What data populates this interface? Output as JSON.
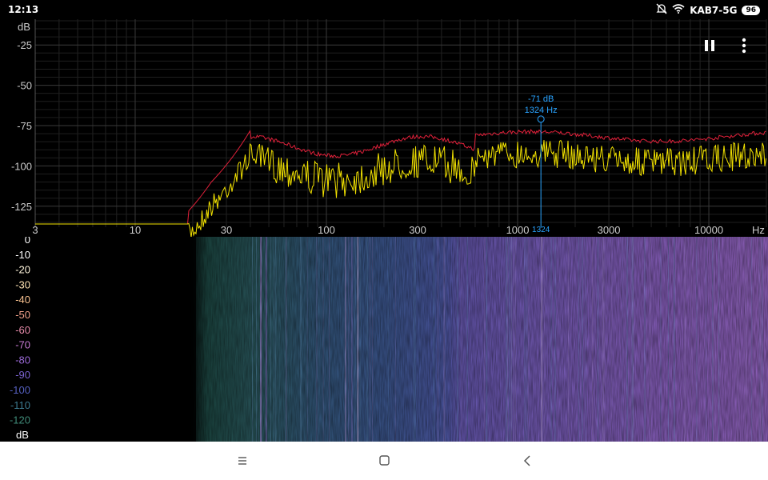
{
  "status_bar": {
    "time": "12:13",
    "network": "KAB7-5G",
    "battery": "96",
    "icons": [
      "mute-bell-icon",
      "wifi-icon"
    ]
  },
  "toolbar": {
    "icons": [
      "pause-icon",
      "more-vert-icon"
    ]
  },
  "spectrum": {
    "y_unit": "dB",
    "y_ticks": [
      "-25",
      "-50",
      "-75",
      "-100",
      "-125"
    ],
    "x_ticks": [
      "3",
      "10",
      "30",
      "100",
      "300",
      "1000",
      "3000",
      "10000"
    ],
    "x_unit": "Hz",
    "cursor": {
      "db_label": "-71 dB",
      "hz_label": "1324 Hz",
      "x_label": "1324",
      "frequency": 1324,
      "db": -71
    },
    "colors": {
      "peak": "#e0203a",
      "current": "#f2e200",
      "cursor": "#29a3ff",
      "grid": "#2e2e2e"
    }
  },
  "spectrogram": {
    "scale_labels": [
      "0",
      "-10",
      "-20",
      "-30",
      "-40",
      "-50",
      "-60",
      "-70",
      "-80",
      "-90",
      "-100",
      "-110",
      "-120"
    ],
    "unit": "dB",
    "scale_colors": [
      "#ffffff",
      "#ffffff",
      "#fff5dc",
      "#ffe3b3",
      "#f8c18f",
      "#f1a08a",
      "#e58aa9",
      "#c77ad3",
      "#9c6ad8",
      "#7b63cf",
      "#5560c0",
      "#3c7a90",
      "#3f8a77"
    ]
  },
  "navbar": {
    "icons": [
      "menu-icon",
      "home-icon",
      "back-icon"
    ]
  }
}
